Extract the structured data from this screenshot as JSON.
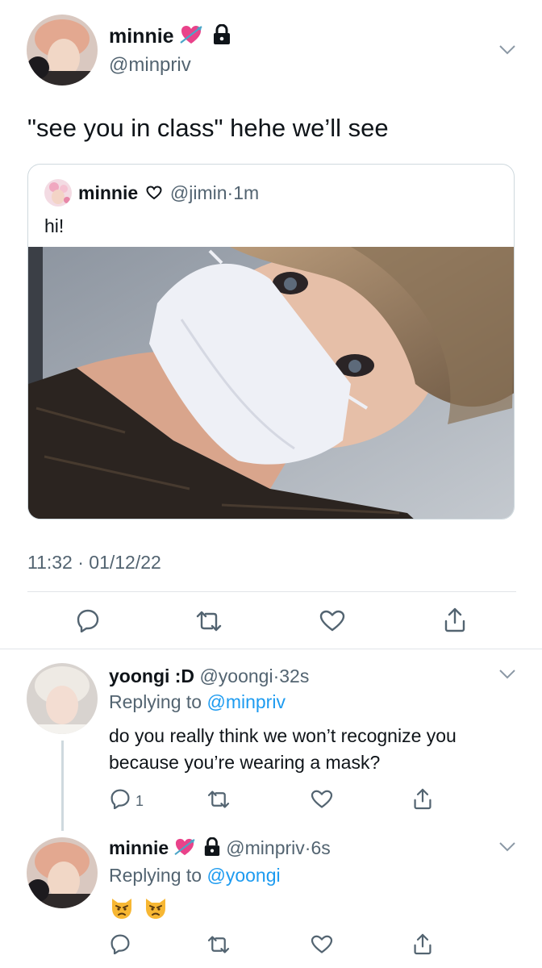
{
  "main_tweet": {
    "display_name": "minnie",
    "handle": "@minpriv",
    "text": "\"see you in class\" hehe we’ll see",
    "timestamp": "11:32 · 01/12/22",
    "quoted": {
      "display_name": "minnie",
      "handle": "@jimin",
      "time": "1m",
      "text": "hi!"
    }
  },
  "reply_1": {
    "display_name": "yoongi :D",
    "handle": "@yoongi",
    "time": "32s",
    "replying_prefix": "Replying to",
    "replying_to": "@minpriv",
    "text_line1": "do you really think we won’t recognize you",
    "text_line2": "because you’re wearing a mask?",
    "reply_count": "1"
  },
  "reply_2": {
    "display_name": "minnie",
    "handle": "@minpriv",
    "time": "6s",
    "replying_prefix": "Replying to",
    "replying_to": "@yoongi",
    "emojis": "😾😾"
  },
  "icons": {
    "badge": "heart-with-arrow-icon",
    "lock": "lock-icon",
    "reply": "reply-icon",
    "retweet": "retweet-icon",
    "like": "heart-icon",
    "share": "share-icon",
    "more": "chevron-down-icon"
  },
  "colors": {
    "link_blue": "#1d9bf0",
    "secondary_text": "#536471",
    "badge_pink": "#e9428a"
  }
}
